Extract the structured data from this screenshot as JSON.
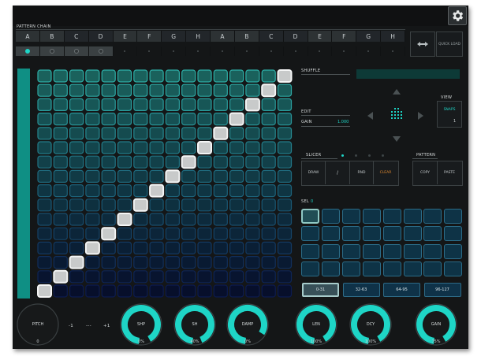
{
  "header": {
    "settings_icon": "gear-icon"
  },
  "pattern_chain": {
    "label": "PATTERN CHAIN",
    "letters": [
      "A",
      "B",
      "C",
      "D",
      "E",
      "F",
      "G",
      "H",
      "A",
      "B",
      "C",
      "D",
      "E",
      "F",
      "G",
      "H"
    ],
    "active_count": 4,
    "current_index": 0,
    "swap_icon": "swap-arrows-icon",
    "quick_load": "QUICK LOAD"
  },
  "sequencer": {
    "rows": 16,
    "cols": 16,
    "active_steps": [
      {
        "step": 1,
        "row": 16
      },
      {
        "step": 2,
        "row": 15
      },
      {
        "step": 3,
        "row": 14
      },
      {
        "step": 4,
        "row": 13
      },
      {
        "step": 5,
        "row": 12
      },
      {
        "step": 6,
        "row": 11
      },
      {
        "step": 7,
        "row": 10
      },
      {
        "step": 8,
        "row": 9
      },
      {
        "step": 9,
        "row": 8
      },
      {
        "step": 10,
        "row": 7
      },
      {
        "step": 11,
        "row": 6
      },
      {
        "step": 12,
        "row": 5
      },
      {
        "step": 13,
        "row": 4
      },
      {
        "step": 14,
        "row": 3
      },
      {
        "step": 15,
        "row": 2
      },
      {
        "step": 16,
        "row": 1
      }
    ],
    "top_color": "#2fb0a8",
    "bottom_color": "#0c1b4f"
  },
  "shuffle": {
    "label": "SHUFFLE"
  },
  "edit": {
    "label": "EDIT",
    "gain_label": "GAIN",
    "gain_value": "1.000"
  },
  "view": {
    "label": "VIEW",
    "snaps_label": "SNAPS",
    "snaps_value": "1"
  },
  "slicer": {
    "label": "SLICER",
    "buttons": [
      "DRAW",
      "/",
      "RND",
      "CLEAR"
    ],
    "clear_color": "#e0882e"
  },
  "pattern": {
    "label": "PATTERN",
    "buttons": [
      "COPY",
      "PASTE"
    ]
  },
  "pads": {
    "sel_label": "SEL",
    "sel_value": "0",
    "rows": 4,
    "cols": 8,
    "selected": 0
  },
  "banks": {
    "items": [
      "0-31",
      "32-63",
      "64-95",
      "96-127"
    ],
    "selected": 0
  },
  "knobs": [
    {
      "name": "PITCH",
      "value": "0",
      "level": 0
    },
    {
      "name": "SHP",
      "value": "0%",
      "level": 0.9
    },
    {
      "name": "SH",
      "value": "40%",
      "level": 0.92
    },
    {
      "name": "DAMP",
      "value": "0%",
      "level": 0.82
    },
    {
      "name": "LEN",
      "value": "100%",
      "level": 0.9
    },
    {
      "name": "DCY",
      "value": "100%",
      "level": 0.9
    },
    {
      "name": "GAIN",
      "value": "75%",
      "level": 0.9
    }
  ],
  "pitch_scale": [
    "-1",
    "---",
    "+1"
  ],
  "accent_color": "#1ed5c6"
}
